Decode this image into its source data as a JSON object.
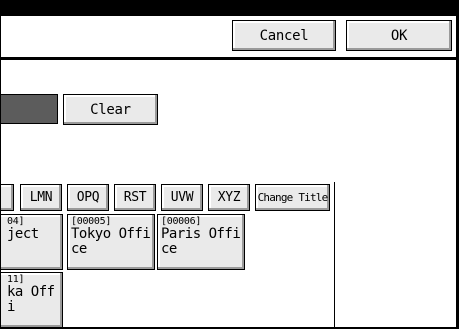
{
  "header": {
    "cancel_label": "Cancel",
    "ok_label": "OK"
  },
  "search": {
    "clear_label": "Clear"
  },
  "title_tabs": [
    {
      "label": "LMN"
    },
    {
      "label": "OPQ"
    },
    {
      "label": "RST"
    },
    {
      "label": "UVW"
    },
    {
      "label": "XYZ"
    }
  ],
  "change_title_label": "Change Title",
  "destinations": [
    {
      "number": "04]",
      "name": "ject"
    },
    {
      "number": "[00005]",
      "name": "Tokyo Office"
    },
    {
      "number": "[00006]",
      "name": "Paris Office"
    },
    {
      "number": "11]",
      "name": "ka Offi"
    }
  ],
  "colors": {
    "button_face": "#eaeaea",
    "dark_field": "#5c5c5c",
    "frame": "#000000"
  }
}
